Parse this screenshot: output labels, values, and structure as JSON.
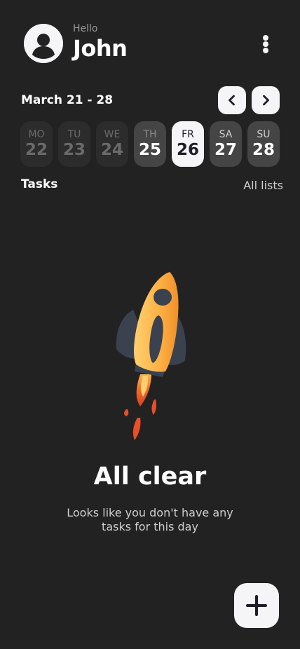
{
  "header": {
    "greeting": "Hello",
    "username": "John",
    "avatar_icon": "user-avatar-icon",
    "menu_icon": "more-vertical-icon"
  },
  "week": {
    "range": "March 21 - 28",
    "prev_icon": "chevron-left-icon",
    "next_icon": "chevron-right-icon",
    "days": [
      {
        "dow": "MO",
        "num": "22",
        "state": "past"
      },
      {
        "dow": "TU",
        "num": "23",
        "state": "past"
      },
      {
        "dow": "WE",
        "num": "24",
        "state": "past"
      },
      {
        "dow": "TH",
        "num": "25",
        "state": "upcoming"
      },
      {
        "dow": "FR",
        "num": "26",
        "state": "selected"
      },
      {
        "dow": "SA",
        "num": "27",
        "state": "upcoming"
      },
      {
        "dow": "SU",
        "num": "28",
        "state": "upcoming"
      }
    ]
  },
  "tasks": {
    "title": "Tasks",
    "all_lists": "All lists"
  },
  "empty_state": {
    "illustration": "rocket-illustration",
    "title": "All clear",
    "message": "Looks like you don't have any tasks for this day"
  },
  "fab": {
    "icon": "plus-icon"
  },
  "colors": {
    "background": "#222222",
    "surface_light": "#f5f5f7",
    "day_past": "#2c2c2c",
    "day_upcoming": "#454545",
    "accent_dark": "#1d1d2b",
    "rocket_body": "#ffb347",
    "rocket_fins": "#3a4250",
    "flame": "#e8502a"
  }
}
